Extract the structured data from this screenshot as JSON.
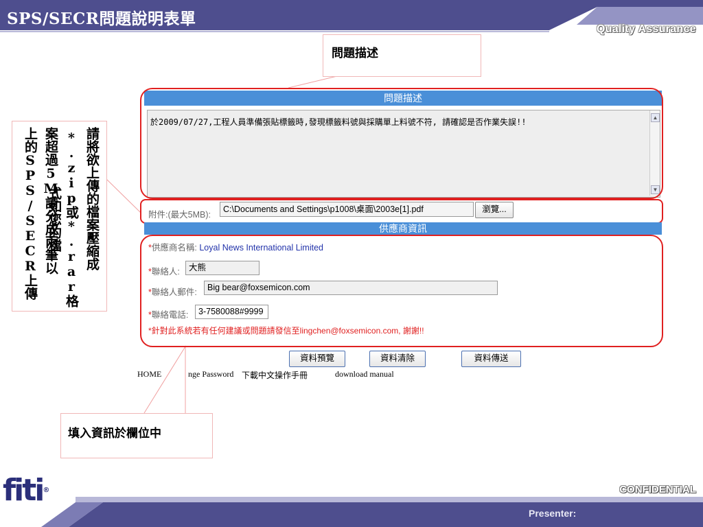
{
  "slide": {
    "title": "SPS/SECR問題說明表單",
    "tagline": "Quality Assurance",
    "confidential": "CONFIDENTIAL",
    "presenter": "Presenter:",
    "logo": "fiti",
    "logo_reg": "®"
  },
  "callouts": {
    "top": "問題描述",
    "bottom": "填入資訊於欄位中",
    "left_columns": [
      "請將欲上傳的檔案壓縮成",
      "*.zip或*.rar格式如您的檔",
      "案超過5M請分成兩筆以",
      "上的SPS/SECR上傳"
    ]
  },
  "form": {
    "problem_header": "問題描述",
    "problem_text": "於2009/07/27,工程人員準備張貼標籤時,發現標籤料號與採購單上料號不符, 請確認是否作業失誤!!",
    "attachment_label": "附件:(最大5MB):",
    "attachment_value": "C:\\Documents and Settings\\p1008\\桌面\\2003e[1].pdf",
    "browse_label": "瀏覽...",
    "supplier_header": "供應商資訊",
    "required_mark": "*",
    "supplier_name_label": "供應商名稱:",
    "supplier_name_value": "Loyal News International Limited",
    "contact_label": "聯絡人:",
    "contact_value": "大熊",
    "email_label": "聯絡人郵件:",
    "email_value": "Big bear@foxsemicon.com",
    "phone_label": "聯絡電話:",
    "phone_value": "3-7580088#9999",
    "notice_prefix": "*針對此系統若有任何建議或問題請發信至",
    "notice_email": "lingchen@foxsemicon.com",
    "notice_suffix": ", 謝謝!!",
    "preview_button": "資料預覽",
    "clear_button": "資料清除",
    "submit_button": "資料傳送"
  },
  "links": {
    "home": "HOME",
    "change_password": "nge Password",
    "download_chinese": "下載中文操作手冊",
    "download_manual": "download manual"
  },
  "colors": {
    "banner": "#4e4e8e",
    "header_bar": "#4a8fd8",
    "highlight": "#e02020",
    "logo": "#2b2f7a"
  }
}
